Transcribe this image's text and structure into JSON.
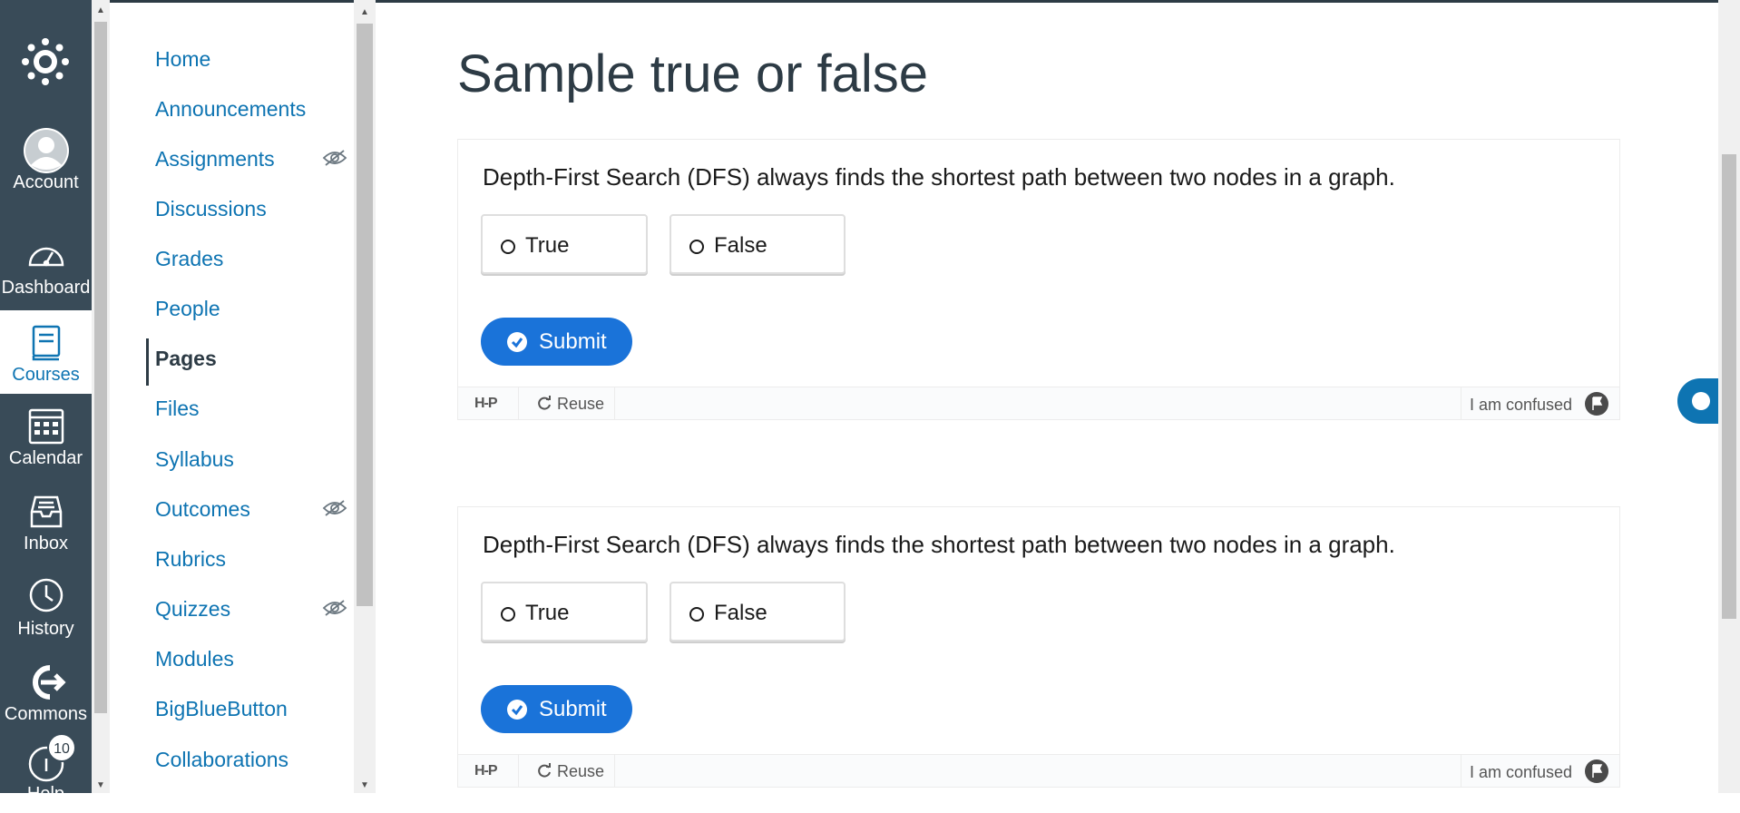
{
  "global_nav": {
    "items": [
      {
        "label": "Account",
        "icon": "avatar-icon"
      },
      {
        "label": "Dashboard",
        "icon": "dashboard-icon"
      },
      {
        "label": "Courses",
        "icon": "courses-icon",
        "active": true
      },
      {
        "label": "Calendar",
        "icon": "calendar-icon"
      },
      {
        "label": "Inbox",
        "icon": "inbox-icon"
      },
      {
        "label": "History",
        "icon": "history-icon"
      },
      {
        "label": "Commons",
        "icon": "commons-icon"
      },
      {
        "label": "Help",
        "icon": "help-icon",
        "badge": "10"
      }
    ]
  },
  "course_nav": {
    "items": [
      {
        "label": "Home"
      },
      {
        "label": "Announcements"
      },
      {
        "label": "Assignments",
        "hidden": true
      },
      {
        "label": "Discussions"
      },
      {
        "label": "Grades"
      },
      {
        "label": "People"
      },
      {
        "label": "Pages",
        "active": true
      },
      {
        "label": "Files"
      },
      {
        "label": "Syllabus"
      },
      {
        "label": "Outcomes",
        "hidden": true
      },
      {
        "label": "Rubrics"
      },
      {
        "label": "Quizzes",
        "hidden": true
      },
      {
        "label": "Modules"
      },
      {
        "label": "BigBlueButton"
      },
      {
        "label": "Collaborations"
      }
    ]
  },
  "page": {
    "title": "Sample true or false"
  },
  "questions": [
    {
      "text": "Depth-First Search (DFS) always finds the shortest path between two nodes in a graph.",
      "options": [
        "True",
        "False"
      ],
      "submit_label": "Submit",
      "footer": {
        "logo": "H-P",
        "reuse": "Reuse",
        "confused": "I am confused"
      }
    },
    {
      "text": "Depth-First Search (DFS) always finds the shortest path between two nodes in a graph.",
      "options": [
        "True",
        "False"
      ],
      "submit_label": "Submit",
      "footer": {
        "logo": "H-P",
        "reuse": "Reuse",
        "confused": "I am confused"
      }
    }
  ],
  "colors": {
    "nav_bg": "#394b58",
    "link": "#0e74b2",
    "submit": "#1a73d9"
  }
}
